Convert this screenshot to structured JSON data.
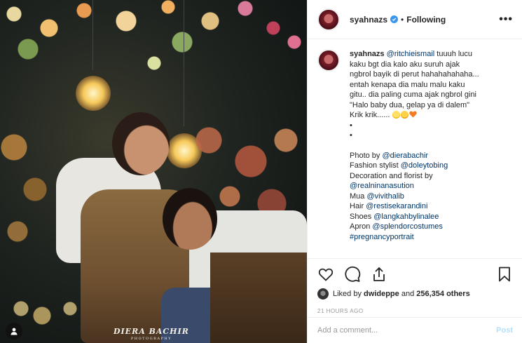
{
  "photo": {
    "watermark_main": "DIERA BACHIR",
    "watermark_sub": "PHOTOGRAPHY",
    "user_badge_icon": "person-icon"
  },
  "header": {
    "username": "syahnazs",
    "separator": "•",
    "follow_status": "Following",
    "more_label": "•••"
  },
  "caption": {
    "username": "syahnazs",
    "mention": "@ritchieismail",
    "text_lines": [
      "tuuuh lucu",
      "kaku bgt dia kalo aku suruh ajak",
      "ngbrol bayik di perut hahahahahaha...",
      "entah kenapa dia malu malu kaku",
      "gitu.. dia paling cuma ajak ngbrol gini",
      "\"Halo baby dua, gelap ya di dalem\"",
      "Krik krik......"
    ],
    "emojis": [
      "grinning-sweat-emoji",
      "smiling-face-emoji",
      "orange-heart-emoji"
    ],
    "bullets": [
      "•",
      "•"
    ],
    "credits": [
      {
        "label": "Photo by",
        "handle": "@dierabachir"
      },
      {
        "label": "Fashion stylist",
        "handle": "@doleytobing"
      },
      {
        "label": "Decoration and florist by",
        "handle": ""
      },
      {
        "label": "",
        "handle": "@realninanasution"
      },
      {
        "label": "Mua",
        "handle": "@vivithalib"
      },
      {
        "label": "Hair",
        "handle": "@restisekarandini"
      },
      {
        "label": "Shoes",
        "handle": "@langkahbylinalee"
      },
      {
        "label": "Apron",
        "handle": "@splendorcostumes"
      },
      {
        "label": "",
        "handle": "#pregnancyportrait"
      }
    ]
  },
  "actions": {
    "like_icon": "heart-icon",
    "comment_icon": "comment-icon",
    "share_icon": "share-icon",
    "save_icon": "bookmark-icon"
  },
  "likes": {
    "prefix": "Liked by",
    "user": "dwideppe",
    "joiner": "and",
    "count": "256,354 others"
  },
  "timestamp": "21 HOURS AGO",
  "comment": {
    "placeholder": "Add a comment...",
    "post_label": "Post"
  },
  "colors": {
    "verified": "#3897f0",
    "mention": "#003569",
    "post_disabled": "#b2dffc",
    "heart_emoji": "#f47b20"
  }
}
